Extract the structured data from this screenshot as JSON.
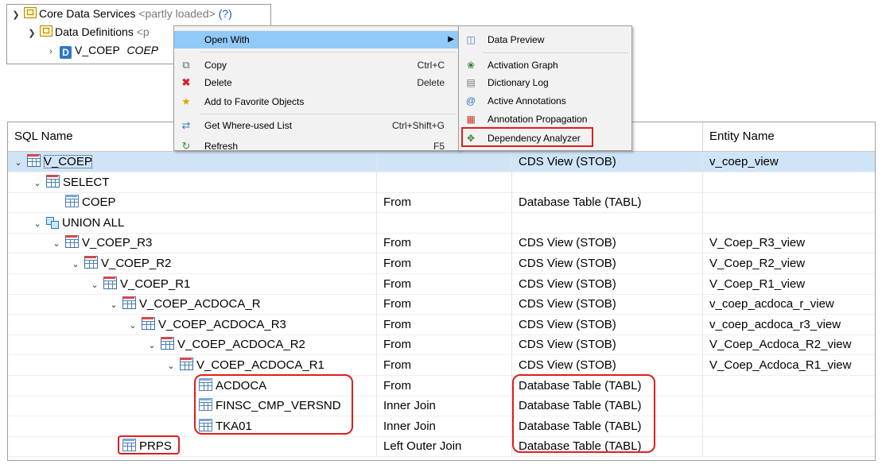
{
  "project_tree": {
    "root_label": "Core Data Services",
    "root_status": "<partly loaded>",
    "root_help": "(?)",
    "child_label": "Data Definitions",
    "child_status": "<p",
    "leaf_name": "V_COEP",
    "leaf_desc": "COEP"
  },
  "context_menu": {
    "items": [
      {
        "label": "Open With",
        "shortcut": "",
        "icon": "none",
        "submenu": true
      },
      {
        "label": "Copy",
        "shortcut": "Ctrl+C",
        "icon": "copy-icon"
      },
      {
        "label": "Delete",
        "shortcut": "Delete",
        "icon": "delete-icon"
      },
      {
        "label": "Add to Favorite Objects",
        "shortcut": "",
        "icon": "star-icon"
      },
      {
        "label": "Get Where-used List",
        "shortcut": "Ctrl+Shift+G",
        "icon": "where-used-icon"
      },
      {
        "label": "Refresh",
        "shortcut": "F5",
        "icon": "refresh-icon"
      }
    ]
  },
  "open_with_submenu": {
    "items": [
      {
        "label": "Data Preview",
        "icon": "data-preview-icon"
      },
      {
        "label": "Activation Graph",
        "icon": "activation-graph-icon"
      },
      {
        "label": "Dictionary Log",
        "icon": "dictionary-log-icon"
      },
      {
        "label": "Active Annotations",
        "icon": "at-icon"
      },
      {
        "label": "Annotation Propagation",
        "icon": "annotation-propagation-icon"
      },
      {
        "label": "Dependency Analyzer",
        "icon": "dependency-analyzer-icon"
      }
    ]
  },
  "table": {
    "headers": [
      "SQL Name",
      "",
      "",
      "Entity Name"
    ],
    "rows": [
      {
        "name": "V_COEP",
        "relation": "",
        "type": "CDS View (STOB)",
        "entity": "v_coep_view",
        "icon": "view",
        "indent": 0,
        "chevron": true
      },
      {
        "name": "SELECT",
        "relation": "",
        "type": "",
        "entity": "",
        "icon": "view",
        "indent": 1,
        "chevron": true
      },
      {
        "name": "COEP",
        "relation": "From",
        "type": "Database Table (TABL)",
        "entity": "",
        "icon": "table",
        "indent": 2,
        "chevron": false
      },
      {
        "name": "UNION ALL",
        "relation": "",
        "type": "",
        "entity": "",
        "icon": "union",
        "indent": 1,
        "chevron": true
      },
      {
        "name": "V_COEP_R3",
        "relation": "From",
        "type": "CDS View (STOB)",
        "entity": "V_Coep_R3_view",
        "icon": "view",
        "indent": 2,
        "chevron": true
      },
      {
        "name": "V_COEP_R2",
        "relation": "From",
        "type": "CDS View (STOB)",
        "entity": "V_Coep_R2_view",
        "icon": "view",
        "indent": 3,
        "chevron": true
      },
      {
        "name": "V_COEP_R1",
        "relation": "From",
        "type": "CDS View (STOB)",
        "entity": "V_Coep_R1_view",
        "icon": "view",
        "indent": 4,
        "chevron": true
      },
      {
        "name": "V_COEP_ACDOCA_R",
        "relation": "From",
        "type": "CDS View (STOB)",
        "entity": "v_coep_acdoca_r_view",
        "icon": "view",
        "indent": 5,
        "chevron": true
      },
      {
        "name": "V_COEP_ACDOCA_R3",
        "relation": "From",
        "type": "CDS View (STOB)",
        "entity": "v_coep_acdoca_r3_view",
        "icon": "view",
        "indent": 6,
        "chevron": true
      },
      {
        "name": "V_COEP_ACDOCA_R2",
        "relation": "From",
        "type": "CDS View (STOB)",
        "entity": "V_Coep_Acdoca_R2_view",
        "icon": "view",
        "indent": 7,
        "chevron": true
      },
      {
        "name": "V_COEP_ACDOCA_R1",
        "relation": "From",
        "type": "CDS View (STOB)",
        "entity": "V_Coep_Acdoca_R1_view",
        "icon": "view",
        "indent": 8,
        "chevron": true
      },
      {
        "name": "ACDOCA",
        "relation": "From",
        "type": "Database Table (TABL)",
        "entity": "",
        "icon": "table",
        "indent": 9,
        "chevron": false
      },
      {
        "name": "FINSC_CMP_VERSND",
        "relation": "Inner Join",
        "type": "Database Table (TABL)",
        "entity": "",
        "icon": "table",
        "indent": 9,
        "chevron": false
      },
      {
        "name": "TKA01",
        "relation": "Inner Join",
        "type": "Database Table (TABL)",
        "entity": "",
        "icon": "table",
        "indent": 9,
        "chevron": false
      },
      {
        "name": "PRPS",
        "relation": "Left Outer Join",
        "type": "Database Table (TABL)",
        "entity": "",
        "icon": "table",
        "indent": 5,
        "chevron": false
      }
    ]
  },
  "colors": {
    "highlight_red": "#e01e1e",
    "selection_blue": "#cfe4f7",
    "menu_hover": "#91c9f7"
  }
}
